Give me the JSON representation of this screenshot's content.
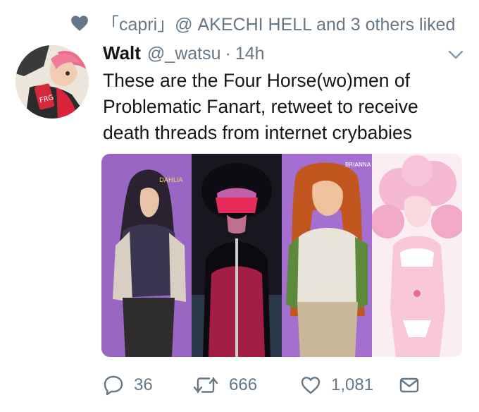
{
  "social_context": {
    "icon": "heart-icon",
    "text": "「capri」@ AKECHI HELL and 3 others liked"
  },
  "tweet": {
    "author_name": "Walt",
    "author_handle": "@_watsu",
    "separator": "·",
    "time": "14h",
    "text": "These are the Four Horse(wo)men of Problematic Fanart, retweet to receive death threads from internet crybabies",
    "avatar_label": "FRG",
    "media_labels": [
      "DAHLIA",
      "BRIANNA"
    ]
  },
  "actions": {
    "reply_count": "36",
    "retweet_count": "666",
    "like_count": "1,081"
  },
  "colors": {
    "text_primary": "#14171a",
    "text_secondary": "#657786",
    "panel_purple": "#9a66c4",
    "panel_pink": "#f6d6e4"
  }
}
